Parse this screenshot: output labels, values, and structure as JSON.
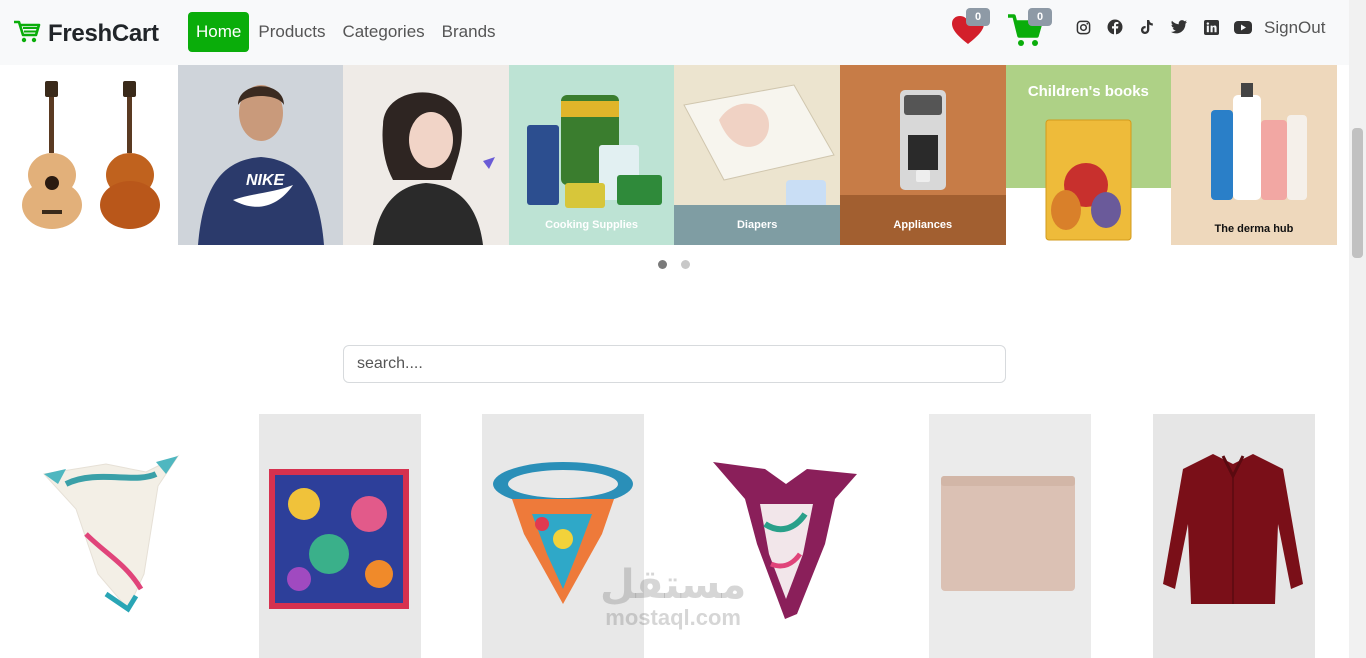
{
  "brand": {
    "name": "FreshCart",
    "accent": "#0aad0a"
  },
  "nav": {
    "links": [
      {
        "label": "Home",
        "active": true
      },
      {
        "label": "Products",
        "active": false
      },
      {
        "label": "Categories",
        "active": false
      },
      {
        "label": "Brands",
        "active": false
      }
    ]
  },
  "wishlist": {
    "icon": "heart-icon",
    "count": "0"
  },
  "cart": {
    "icon": "cart-icon",
    "count": "0"
  },
  "socials": [
    "instagram-icon",
    "facebook-icon",
    "tiktok-icon",
    "twitter-icon",
    "linkedin-icon",
    "youtube-icon"
  ],
  "signout_label": "SignOut",
  "slider": {
    "slides": [
      {
        "caption": ""
      },
      {
        "caption": ""
      },
      {
        "caption": ""
      },
      {
        "caption": "Cooking Supplies"
      },
      {
        "caption": "Diapers"
      },
      {
        "caption": "Appliances"
      },
      {
        "caption": "Children's books"
      },
      {
        "caption": "The derma hub"
      }
    ],
    "dots": 2,
    "active_dot": 0
  },
  "search": {
    "placeholder": "search...."
  },
  "watermark": {
    "arabic": "مستقل",
    "latin": "mostaql.com"
  }
}
